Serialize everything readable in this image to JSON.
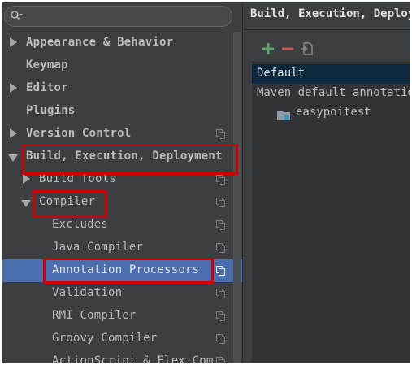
{
  "search": {
    "placeholder": ""
  },
  "sidebar": {
    "items": [
      {
        "label": "Appearance & Behavior",
        "arrow": "right",
        "copy": false
      },
      {
        "label": "Keymap",
        "arrow": "none",
        "copy": false
      },
      {
        "label": "Editor",
        "arrow": "right",
        "copy": false
      },
      {
        "label": "Plugins",
        "arrow": "none",
        "copy": false
      },
      {
        "label": "Version Control",
        "arrow": "right",
        "copy": true
      },
      {
        "label": "Build, Execution, Deployment",
        "arrow": "down",
        "copy": false
      },
      {
        "label": "Build Tools",
        "arrow": "right",
        "copy": true
      },
      {
        "label": "Compiler",
        "arrow": "down",
        "copy": true
      },
      {
        "label": "Excludes",
        "arrow": "none",
        "copy": true
      },
      {
        "label": "Java Compiler",
        "arrow": "none",
        "copy": true
      },
      {
        "label": "Annotation Processors",
        "arrow": "none",
        "copy": true,
        "selected": true
      },
      {
        "label": "Validation",
        "arrow": "none",
        "copy": true
      },
      {
        "label": "RMI Compiler",
        "arrow": "none",
        "copy": true
      },
      {
        "label": "Groovy Compiler",
        "arrow": "none",
        "copy": true
      },
      {
        "label": "ActionScript & Flex Compiler",
        "arrow": "none",
        "copy": true
      }
    ]
  },
  "main": {
    "title": "Build, Execution, Deployment › Compiler › Annotation Processors",
    "toolbar": {
      "add_icon": "plus-icon",
      "remove_icon": "minus-icon",
      "move_icon": "move-to-group-icon"
    },
    "profiles": [
      {
        "label": "Default",
        "selected": true
      },
      {
        "label": "Maven default annotation processors profile"
      }
    ],
    "module": {
      "label": "easypoitest",
      "icon": "module-folder-icon"
    }
  },
  "colors": {
    "background": "#3c3f41",
    "selection": "#4b6eaf",
    "panel_selection": "#0d293e",
    "highlight_box": "#d00000",
    "add": "#59a869",
    "remove": "#c75450"
  }
}
